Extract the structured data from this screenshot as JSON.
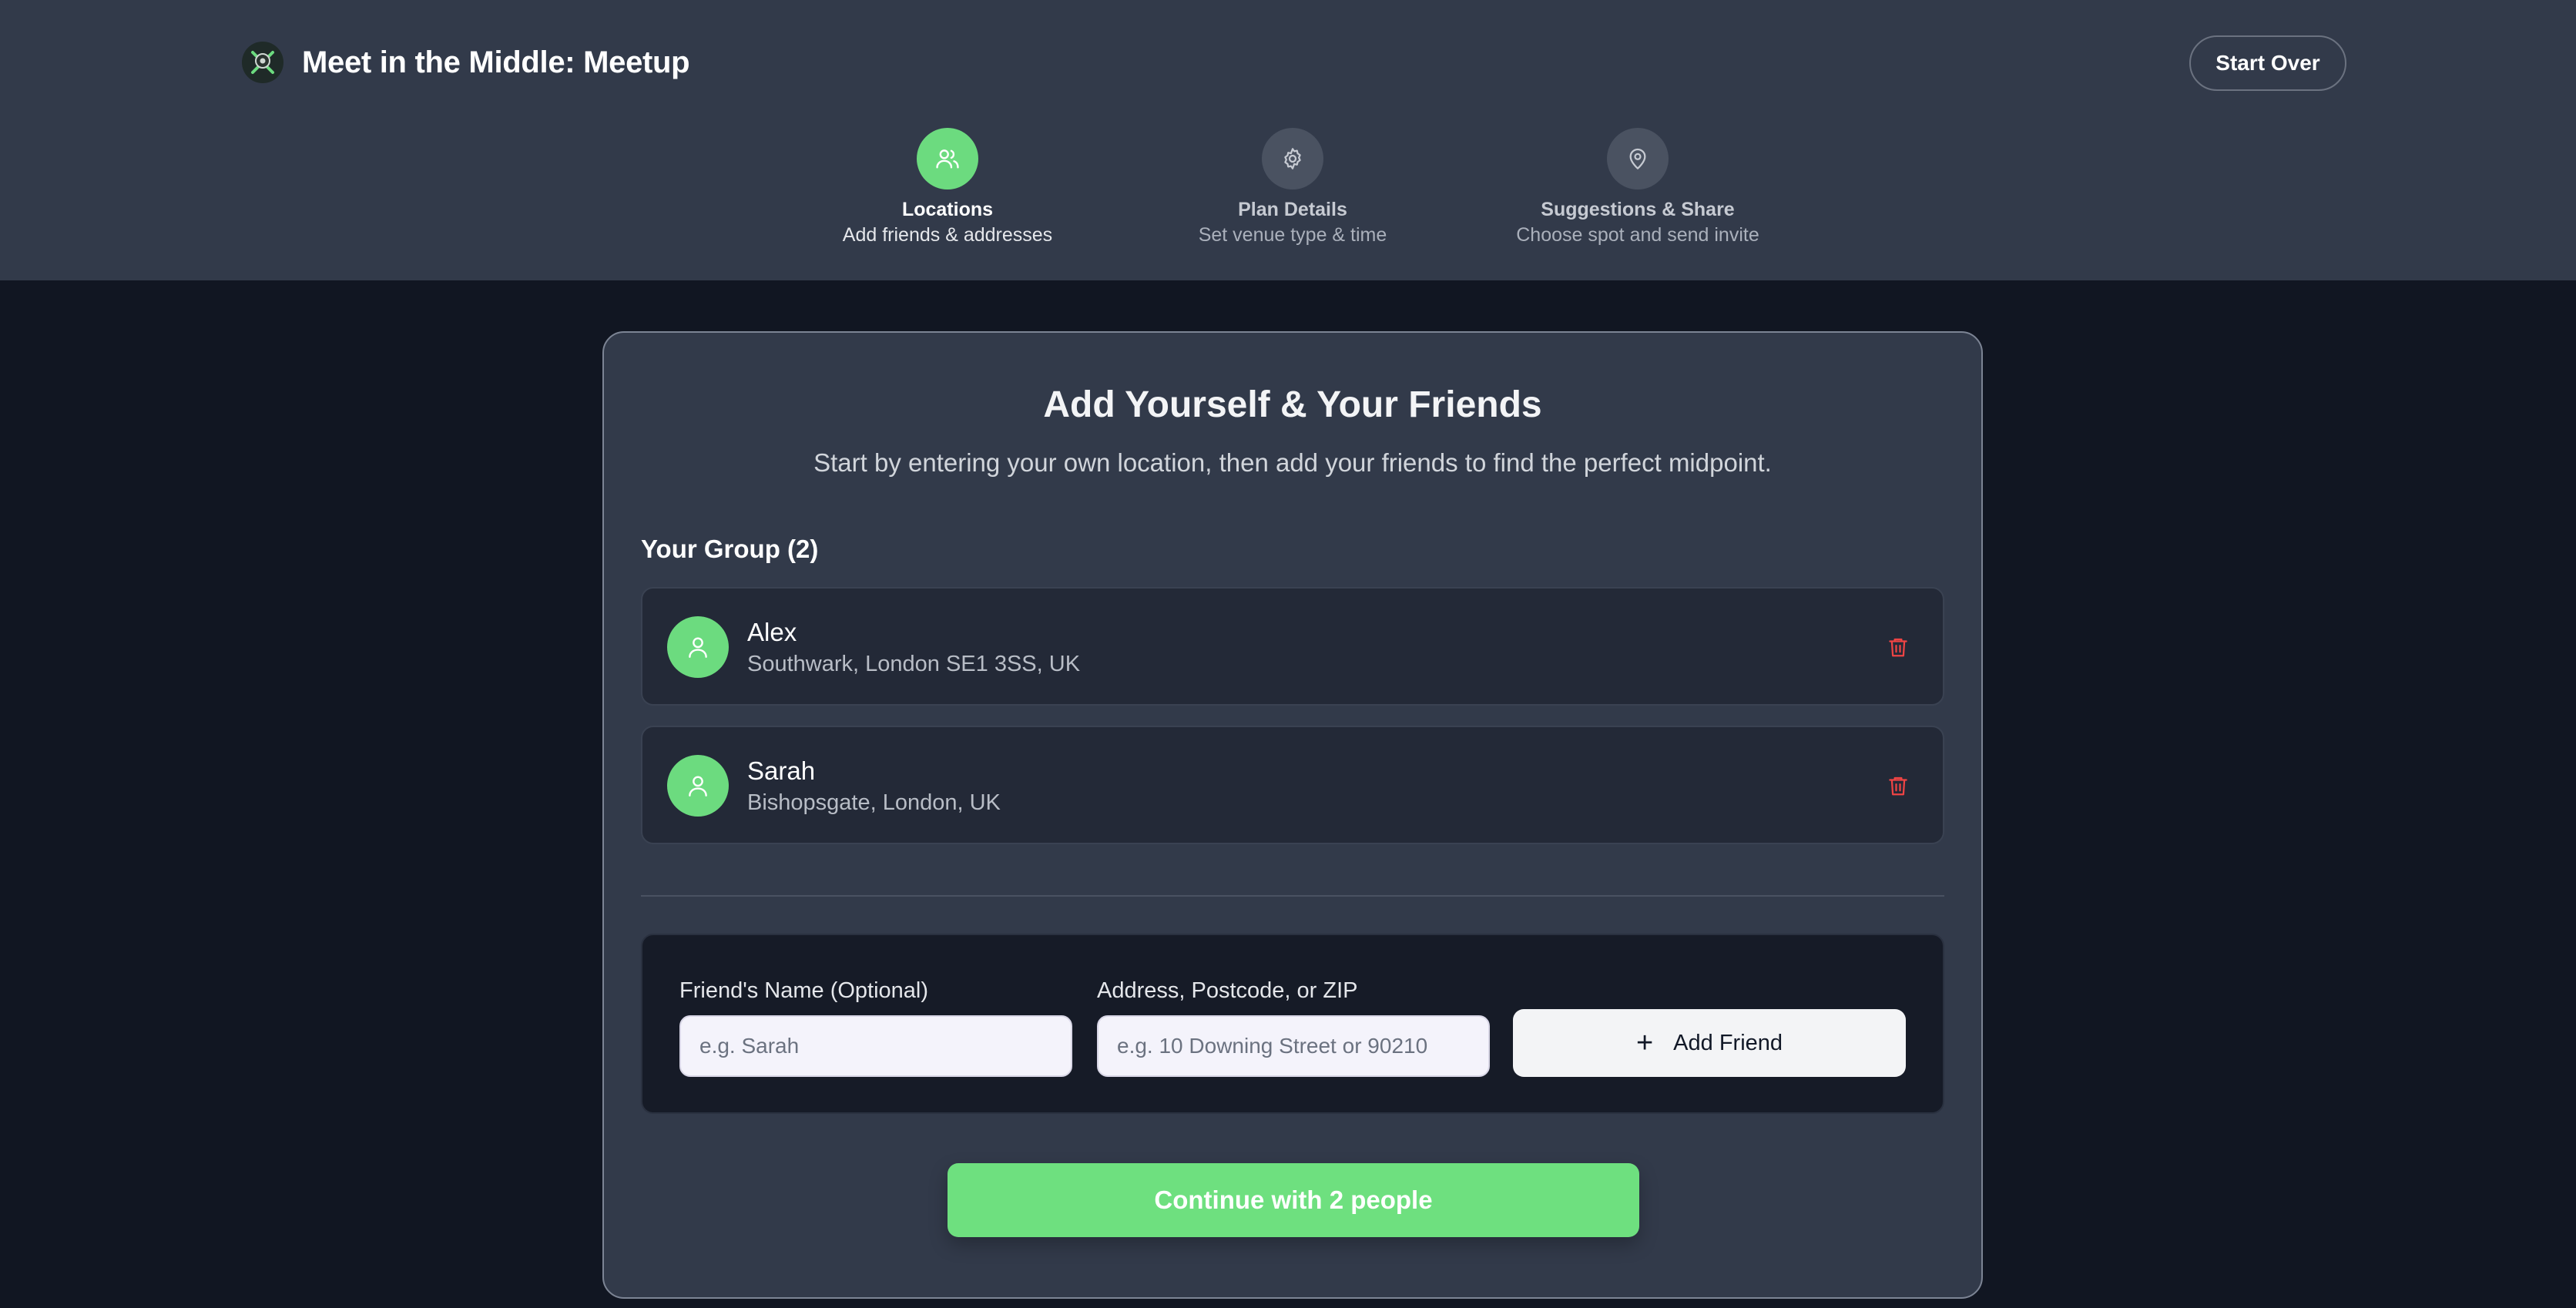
{
  "app": {
    "title": "Meet in the Middle: Meetup",
    "start_over_label": "Start Over"
  },
  "steps": [
    {
      "title": "Locations",
      "subtitle": "Add friends & addresses",
      "icon": "users-icon",
      "active": true
    },
    {
      "title": "Plan Details",
      "subtitle": "Set venue type & time",
      "icon": "gear-icon",
      "active": false
    },
    {
      "title": "Suggestions & Share",
      "subtitle": "Choose spot and send invite",
      "icon": "map-pin-icon",
      "active": false
    }
  ],
  "card": {
    "heading": "Add Yourself & Your Friends",
    "lead": "Start by entering your own location, then add your friends to find the perfect midpoint.",
    "group_label": "Your Group (2)"
  },
  "members": [
    {
      "name": "Alex",
      "address": "Southwark, London SE1 3SS, UK"
    },
    {
      "name": "Sarah",
      "address": "Bishopsgate, London, UK"
    }
  ],
  "form": {
    "name_label": "Friend's Name (Optional)",
    "name_placeholder": "e.g. Sarah",
    "name_value": "",
    "address_label": "Address, Postcode, or ZIP",
    "address_placeholder": "e.g. 10 Downing Street or 90210",
    "address_value": "",
    "add_button_label": "Add Friend"
  },
  "continue_label": "Continue with 2 people",
  "colors": {
    "accent": "#6cdb7f",
    "header_bg": "#323a4a",
    "page_bg": "#111622",
    "danger": "#ef4444"
  }
}
